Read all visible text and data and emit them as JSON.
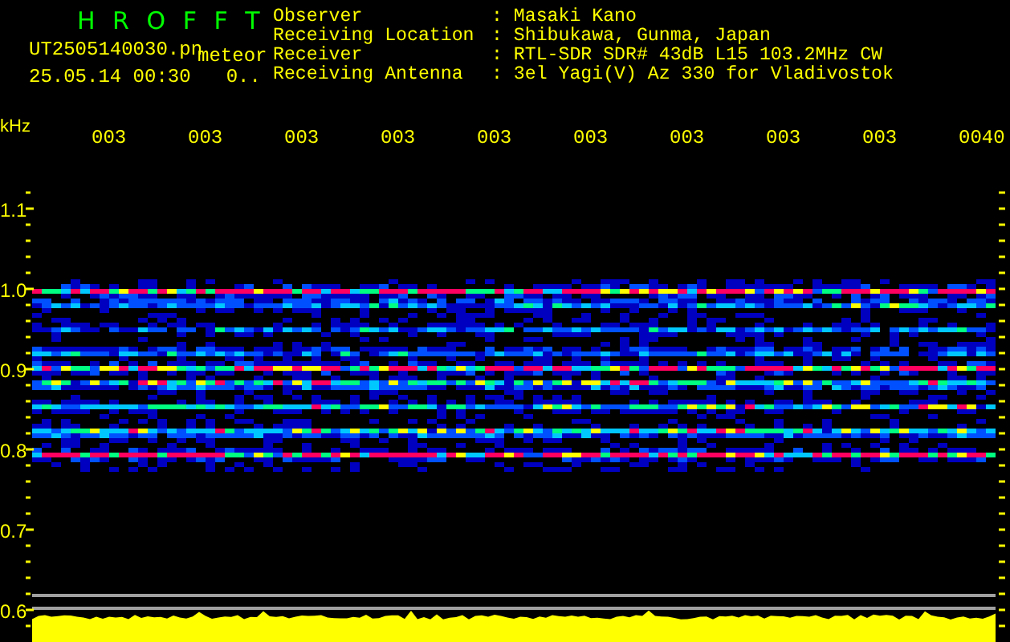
{
  "header": {
    "title": "H R O F F T",
    "file": "UT2505140030.pn",
    "tag": "meteor",
    "datetime": "25.05.14 00:30",
    "counter": "0.."
  },
  "info": [
    {
      "label": "Observer",
      "value": ": Masaki Kano"
    },
    {
      "label": "Receiving Location",
      "value": ": Shibukawa, Gunma, Japan"
    },
    {
      "label": "Receiver",
      "value": ": RTL-SDR SDR# 43dB L15 103.2MHz CW"
    },
    {
      "label": "Receiving Antenna",
      "value": ": 3el Yagi(V) Az 330 for Vladivostok"
    }
  ],
  "plot": {
    "y_unit": "kHz",
    "time_labels": [
      "003",
      "003",
      "003",
      "003",
      "003",
      "003",
      "003",
      "003",
      "003",
      "0040"
    ],
    "y_labels": [
      "1.1",
      "1.0",
      "0.9",
      "0.8",
      "0.7",
      "0.6"
    ]
  }
}
